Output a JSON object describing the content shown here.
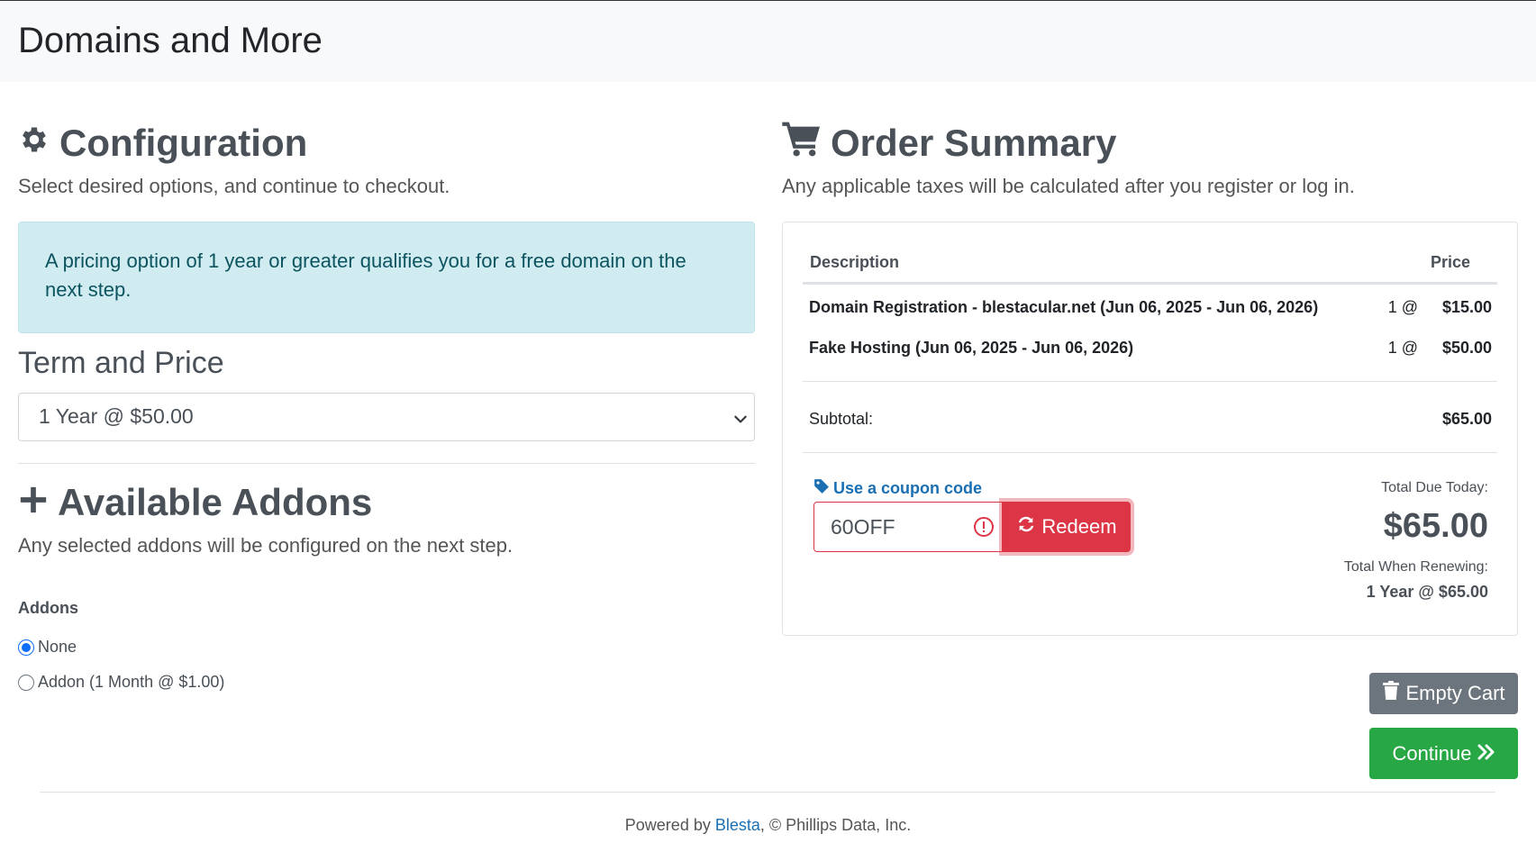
{
  "header": {
    "title": "Domains and More"
  },
  "configuration": {
    "title": "Configuration",
    "subtitle": "Select desired options, and continue to checkout.",
    "alert": "A pricing option of 1 year or greater qualifies you for a free domain on the next step.",
    "term_label": "Term and Price",
    "term_selected": "1 Year @ $50.00"
  },
  "addons": {
    "title": "Available Addons",
    "subtitle": "Any selected addons will be configured on the next step.",
    "label": "Addons",
    "options": [
      {
        "label": "None",
        "checked": true
      },
      {
        "label": "Addon (1 Month @ $1.00)",
        "checked": false
      }
    ]
  },
  "summary": {
    "title": "Order Summary",
    "subtitle": "Any applicable taxes will be calculated after you register or log in.",
    "col_description": "Description",
    "col_price": "Price",
    "items": [
      {
        "description": "Domain Registration - blestacular.net (Jun 06, 2025 - Jun 06, 2026)",
        "qty": "1 @",
        "price": "$15.00"
      },
      {
        "description": "Fake Hosting (Jun 06, 2025 - Jun 06, 2026)",
        "qty": "1 @",
        "price": "$50.00"
      }
    ],
    "subtotal_label": "Subtotal:",
    "subtotal_value": "$65.00",
    "coupon_link": "Use a coupon code",
    "coupon_value": "60OFF",
    "redeem_label": "Redeem",
    "total_due_label": "Total Due Today:",
    "total_due_value": "$65.00",
    "renew_label": "Total When Renewing:",
    "renew_value": "1 Year @ $65.00"
  },
  "actions": {
    "empty_cart": "Empty Cart",
    "continue": "Continue"
  },
  "footer": {
    "prefix": "Powered by ",
    "link": "Blesta",
    "suffix": ", © Phillips Data, Inc."
  },
  "colors": {
    "danger": "#dc3545",
    "success": "#28a745",
    "secondary": "#6c757d",
    "info_bg": "#d1ecf1",
    "link": "#1a6fb3"
  }
}
